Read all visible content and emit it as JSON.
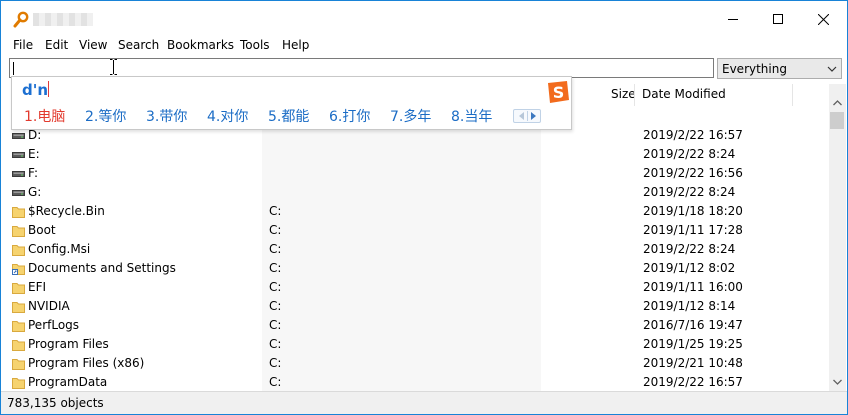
{
  "window": {
    "title_obscured": true
  },
  "menu": [
    "File",
    "Edit",
    "View",
    "Search",
    "Bookmarks",
    "Tools",
    "Help"
  ],
  "search": {
    "value": "",
    "filter": "Everything"
  },
  "columns": {
    "size": "Size",
    "date_modified": "Date Modified"
  },
  "ime": {
    "composition": "d'n",
    "candidates": [
      "1.电脑",
      "2.等你",
      "3.带你",
      "4.对你",
      "5.都能",
      "6.打你",
      "7.多年",
      "8.当年"
    ],
    "logo_letter": "S"
  },
  "rows": [
    {
      "name": "D:",
      "path": "",
      "date": "2019/2/22 16:57",
      "icon": "drive-icon"
    },
    {
      "name": "E:",
      "path": "",
      "date": "2019/2/22 8:24",
      "icon": "drive-icon"
    },
    {
      "name": "F:",
      "path": "",
      "date": "2019/2/22 16:56",
      "icon": "drive-icon"
    },
    {
      "name": "G:",
      "path": "",
      "date": "2019/2/22 8:24",
      "icon": "drive-icon"
    },
    {
      "name": "$Recycle.Bin",
      "path": "C:",
      "date": "2019/1/18 18:20",
      "icon": "folder-icon"
    },
    {
      "name": "Boot",
      "path": "C:",
      "date": "2019/1/11 17:28",
      "icon": "folder-icon"
    },
    {
      "name": "Config.Msi",
      "path": "C:",
      "date": "2019/2/22 8:24",
      "icon": "folder-icon"
    },
    {
      "name": "Documents and Settings",
      "path": "C:",
      "date": "2019/1/12 8:02",
      "icon": "shortcut-folder-icon"
    },
    {
      "name": "EFI",
      "path": "C:",
      "date": "2019/1/11 16:00",
      "icon": "folder-icon"
    },
    {
      "name": "NVIDIA",
      "path": "C:",
      "date": "2019/1/12 8:14",
      "icon": "folder-icon"
    },
    {
      "name": "PerfLogs",
      "path": "C:",
      "date": "2016/7/16 19:47",
      "icon": "folder-icon"
    },
    {
      "name": "Program Files",
      "path": "C:",
      "date": "2019/1/25 19:25",
      "icon": "folder-icon"
    },
    {
      "name": "Program Files (x86)",
      "path": "C:",
      "date": "2019/2/21 10:48",
      "icon": "folder-icon"
    },
    {
      "name": "ProgramData",
      "path": "C:",
      "date": "2019/2/22 16:57",
      "icon": "folder-icon"
    }
  ],
  "status": {
    "count": "783,135 objects"
  },
  "colors": {
    "window_border": "#1883d7",
    "ime_selected": "#e23a2e",
    "ime_candidate": "#1b6cc5",
    "folder": "#f6d36f"
  }
}
